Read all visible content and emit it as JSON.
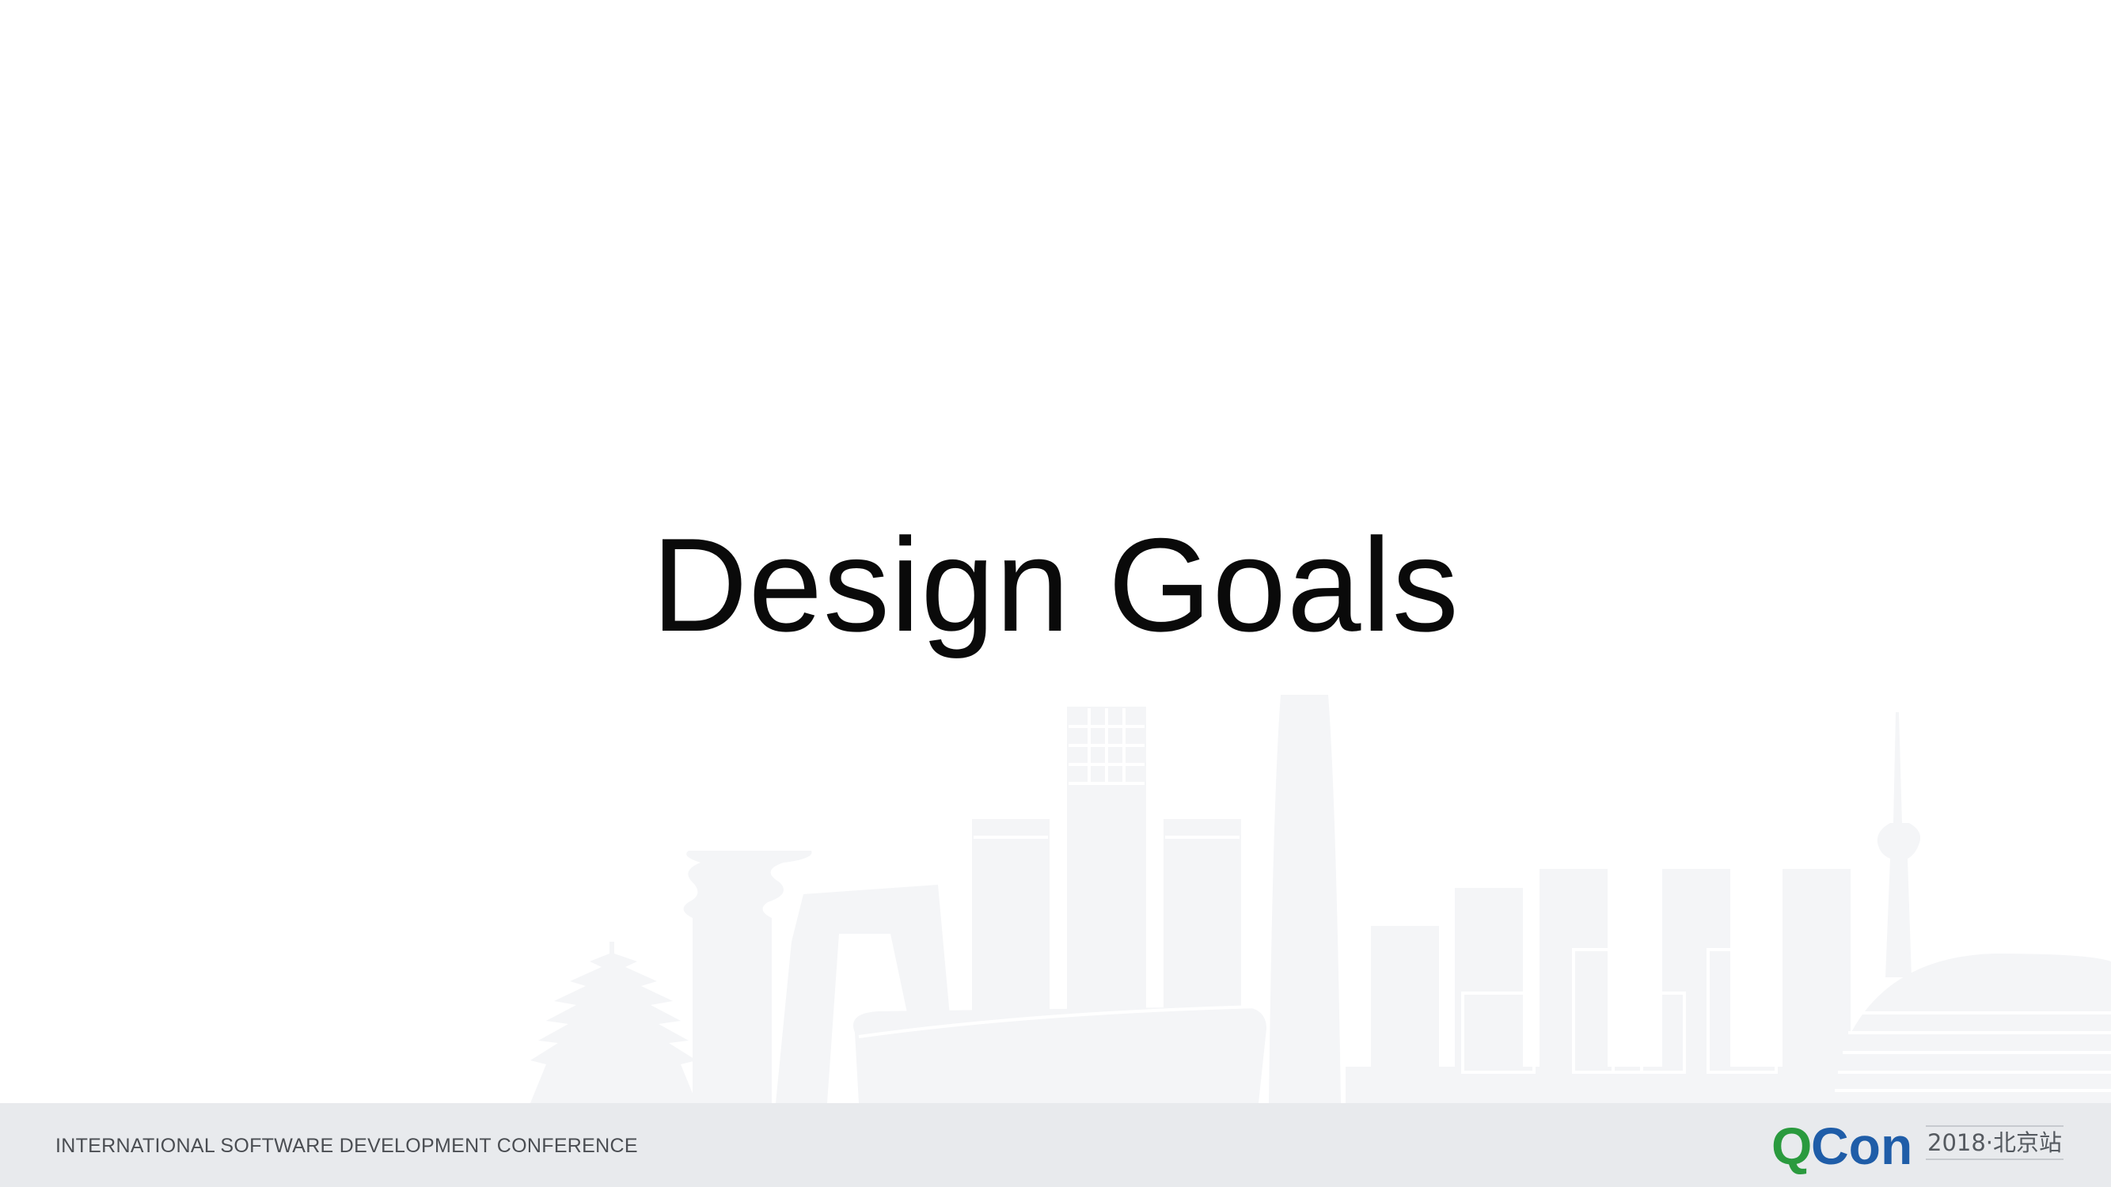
{
  "slide": {
    "title": "Design Goals"
  },
  "footer": {
    "conference_name": "INTERNATIONAL SOFTWARE DEVELOPMENT CONFERENCE",
    "logo_q": "Q",
    "logo_con": "Con",
    "logo_edition": "2018·北京站"
  },
  "colors": {
    "background": "#ffffff",
    "footer_band": "#e8eaed",
    "skyline": "#f4f5f7",
    "logo_green": "#2a9a3e",
    "logo_blue": "#1f5da8",
    "title_text": "#0a0a0a"
  }
}
